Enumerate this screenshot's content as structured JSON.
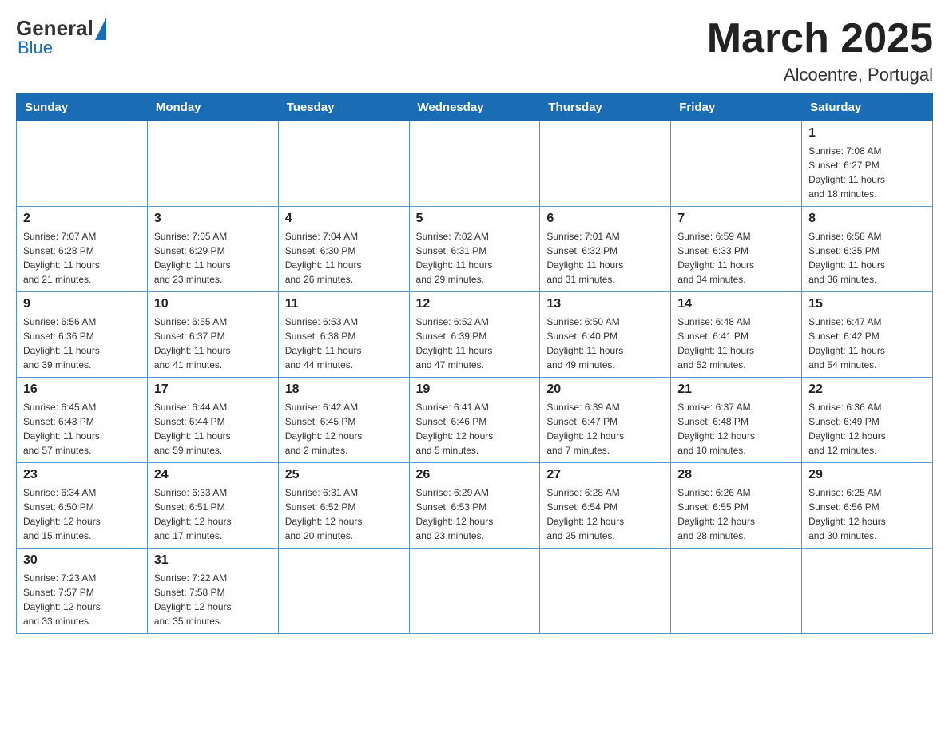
{
  "logo": {
    "general": "General",
    "blue": "Blue"
  },
  "title": "March 2025",
  "location": "Alcoentre, Portugal",
  "days_of_week": [
    "Sunday",
    "Monday",
    "Tuesday",
    "Wednesday",
    "Thursday",
    "Friday",
    "Saturday"
  ],
  "weeks": [
    [
      {
        "day": "",
        "info": ""
      },
      {
        "day": "",
        "info": ""
      },
      {
        "day": "",
        "info": ""
      },
      {
        "day": "",
        "info": ""
      },
      {
        "day": "",
        "info": ""
      },
      {
        "day": "",
        "info": ""
      },
      {
        "day": "1",
        "info": "Sunrise: 7:08 AM\nSunset: 6:27 PM\nDaylight: 11 hours\nand 18 minutes."
      }
    ],
    [
      {
        "day": "2",
        "info": "Sunrise: 7:07 AM\nSunset: 6:28 PM\nDaylight: 11 hours\nand 21 minutes."
      },
      {
        "day": "3",
        "info": "Sunrise: 7:05 AM\nSunset: 6:29 PM\nDaylight: 11 hours\nand 23 minutes."
      },
      {
        "day": "4",
        "info": "Sunrise: 7:04 AM\nSunset: 6:30 PM\nDaylight: 11 hours\nand 26 minutes."
      },
      {
        "day": "5",
        "info": "Sunrise: 7:02 AM\nSunset: 6:31 PM\nDaylight: 11 hours\nand 29 minutes."
      },
      {
        "day": "6",
        "info": "Sunrise: 7:01 AM\nSunset: 6:32 PM\nDaylight: 11 hours\nand 31 minutes."
      },
      {
        "day": "7",
        "info": "Sunrise: 6:59 AM\nSunset: 6:33 PM\nDaylight: 11 hours\nand 34 minutes."
      },
      {
        "day": "8",
        "info": "Sunrise: 6:58 AM\nSunset: 6:35 PM\nDaylight: 11 hours\nand 36 minutes."
      }
    ],
    [
      {
        "day": "9",
        "info": "Sunrise: 6:56 AM\nSunset: 6:36 PM\nDaylight: 11 hours\nand 39 minutes."
      },
      {
        "day": "10",
        "info": "Sunrise: 6:55 AM\nSunset: 6:37 PM\nDaylight: 11 hours\nand 41 minutes."
      },
      {
        "day": "11",
        "info": "Sunrise: 6:53 AM\nSunset: 6:38 PM\nDaylight: 11 hours\nand 44 minutes."
      },
      {
        "day": "12",
        "info": "Sunrise: 6:52 AM\nSunset: 6:39 PM\nDaylight: 11 hours\nand 47 minutes."
      },
      {
        "day": "13",
        "info": "Sunrise: 6:50 AM\nSunset: 6:40 PM\nDaylight: 11 hours\nand 49 minutes."
      },
      {
        "day": "14",
        "info": "Sunrise: 6:48 AM\nSunset: 6:41 PM\nDaylight: 11 hours\nand 52 minutes."
      },
      {
        "day": "15",
        "info": "Sunrise: 6:47 AM\nSunset: 6:42 PM\nDaylight: 11 hours\nand 54 minutes."
      }
    ],
    [
      {
        "day": "16",
        "info": "Sunrise: 6:45 AM\nSunset: 6:43 PM\nDaylight: 11 hours\nand 57 minutes."
      },
      {
        "day": "17",
        "info": "Sunrise: 6:44 AM\nSunset: 6:44 PM\nDaylight: 11 hours\nand 59 minutes."
      },
      {
        "day": "18",
        "info": "Sunrise: 6:42 AM\nSunset: 6:45 PM\nDaylight: 12 hours\nand 2 minutes."
      },
      {
        "day": "19",
        "info": "Sunrise: 6:41 AM\nSunset: 6:46 PM\nDaylight: 12 hours\nand 5 minutes."
      },
      {
        "day": "20",
        "info": "Sunrise: 6:39 AM\nSunset: 6:47 PM\nDaylight: 12 hours\nand 7 minutes."
      },
      {
        "day": "21",
        "info": "Sunrise: 6:37 AM\nSunset: 6:48 PM\nDaylight: 12 hours\nand 10 minutes."
      },
      {
        "day": "22",
        "info": "Sunrise: 6:36 AM\nSunset: 6:49 PM\nDaylight: 12 hours\nand 12 minutes."
      }
    ],
    [
      {
        "day": "23",
        "info": "Sunrise: 6:34 AM\nSunset: 6:50 PM\nDaylight: 12 hours\nand 15 minutes."
      },
      {
        "day": "24",
        "info": "Sunrise: 6:33 AM\nSunset: 6:51 PM\nDaylight: 12 hours\nand 17 minutes."
      },
      {
        "day": "25",
        "info": "Sunrise: 6:31 AM\nSunset: 6:52 PM\nDaylight: 12 hours\nand 20 minutes."
      },
      {
        "day": "26",
        "info": "Sunrise: 6:29 AM\nSunset: 6:53 PM\nDaylight: 12 hours\nand 23 minutes."
      },
      {
        "day": "27",
        "info": "Sunrise: 6:28 AM\nSunset: 6:54 PM\nDaylight: 12 hours\nand 25 minutes."
      },
      {
        "day": "28",
        "info": "Sunrise: 6:26 AM\nSunset: 6:55 PM\nDaylight: 12 hours\nand 28 minutes."
      },
      {
        "day": "29",
        "info": "Sunrise: 6:25 AM\nSunset: 6:56 PM\nDaylight: 12 hours\nand 30 minutes."
      }
    ],
    [
      {
        "day": "30",
        "info": "Sunrise: 7:23 AM\nSunset: 7:57 PM\nDaylight: 12 hours\nand 33 minutes."
      },
      {
        "day": "31",
        "info": "Sunrise: 7:22 AM\nSunset: 7:58 PM\nDaylight: 12 hours\nand 35 minutes."
      },
      {
        "day": "",
        "info": ""
      },
      {
        "day": "",
        "info": ""
      },
      {
        "day": "",
        "info": ""
      },
      {
        "day": "",
        "info": ""
      },
      {
        "day": "",
        "info": ""
      }
    ]
  ]
}
